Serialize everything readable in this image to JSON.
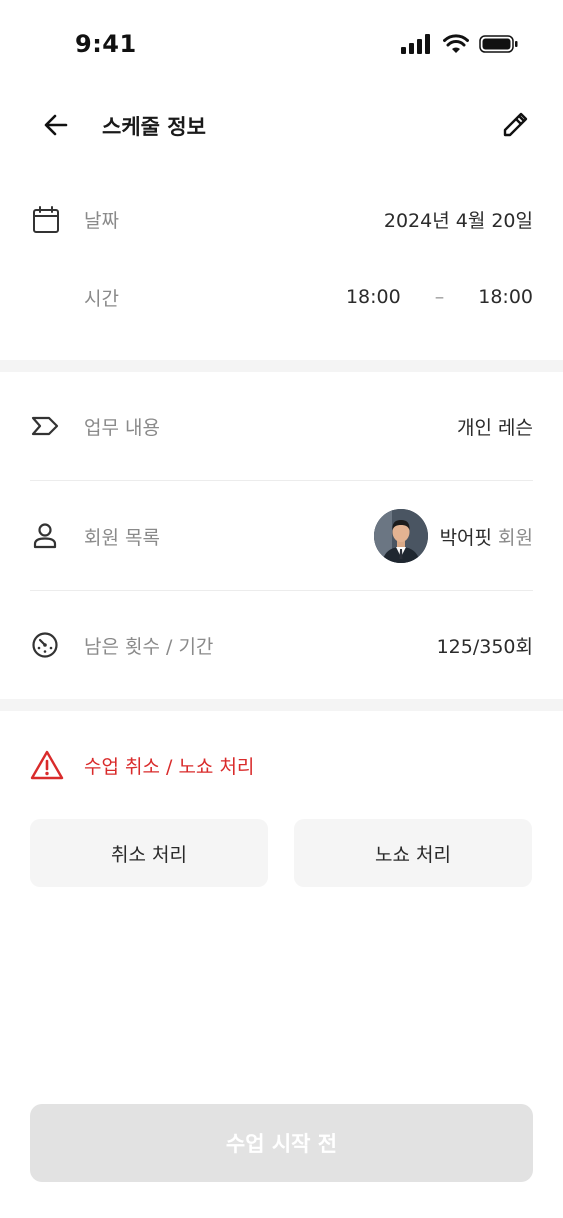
{
  "status_bar": {
    "time": "9:41"
  },
  "header": {
    "title": "스케줄 정보"
  },
  "date_row": {
    "label": "날짜",
    "value": "2024년 4월 20일"
  },
  "time_row": {
    "label": "시간",
    "start": "18:00",
    "separator": "–",
    "end": "18:00"
  },
  "task_row": {
    "label": "업무 내용",
    "value": "개인 레슨"
  },
  "member_row": {
    "label": "회원 목록",
    "name": "박어핏",
    "suffix": "회원"
  },
  "remaining_row": {
    "label": "남은 횟수 / 기간",
    "value": "125/350회"
  },
  "cancel_section": {
    "title": "수업 취소 / 노쇼 처리",
    "cancel_button": "취소 처리",
    "noshow_button": "노쇼 처리"
  },
  "primary_button": {
    "label": "수업 시작 전"
  },
  "colors": {
    "warning": "#d92b2b",
    "disabled_button": "#e2e2e2",
    "section_gap": "#f4f4f4"
  }
}
